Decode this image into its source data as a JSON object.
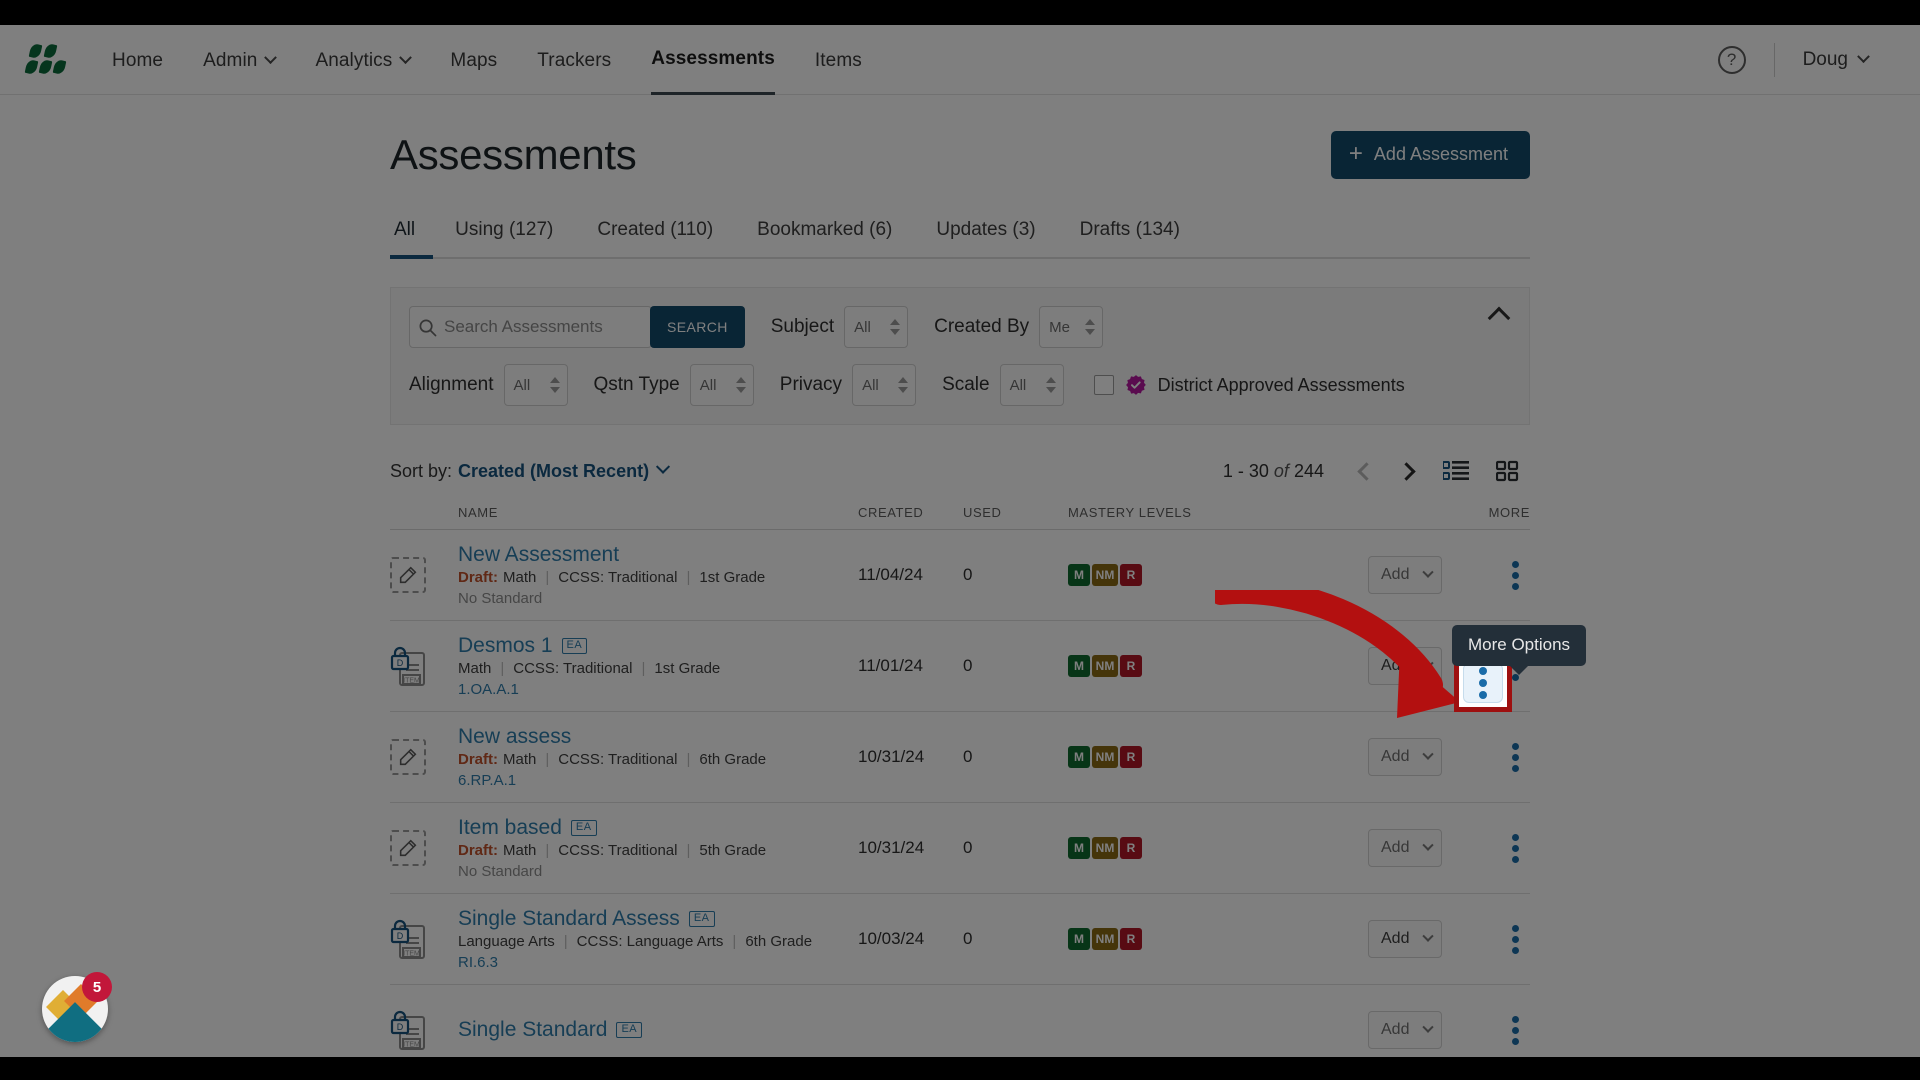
{
  "nav": {
    "logo_name": "logo-icon",
    "items": [
      {
        "label": "Home",
        "dropdown": false,
        "active": false
      },
      {
        "label": "Admin",
        "dropdown": true,
        "active": false
      },
      {
        "label": "Analytics",
        "dropdown": true,
        "active": false
      },
      {
        "label": "Maps",
        "dropdown": false,
        "active": false
      },
      {
        "label": "Trackers",
        "dropdown": false,
        "active": false
      },
      {
        "label": "Assessments",
        "dropdown": false,
        "active": true
      },
      {
        "label": "Items",
        "dropdown": false,
        "active": false
      }
    ],
    "help_icon": "?",
    "user": "Doug"
  },
  "header": {
    "title": "Assessments",
    "add_button": "Add Assessment"
  },
  "tabs": [
    {
      "label": "All",
      "active": true
    },
    {
      "label": "Using (127)",
      "active": false
    },
    {
      "label": "Created (110)",
      "active": false
    },
    {
      "label": "Bookmarked (6)",
      "active": false
    },
    {
      "label": "Updates (3)",
      "active": false
    },
    {
      "label": "Drafts (134)",
      "active": false
    }
  ],
  "search": {
    "placeholder": "Search Assessments",
    "value": "",
    "button": "SEARCH"
  },
  "filters_row1": [
    {
      "label": "Subject",
      "value": "All"
    },
    {
      "label": "Created By",
      "value": "Me"
    }
  ],
  "filters_row2": [
    {
      "label": "Alignment",
      "value": "All"
    },
    {
      "label": "Qstn Type",
      "value": "All"
    },
    {
      "label": "Privacy",
      "value": "All"
    },
    {
      "label": "Scale",
      "value": "All"
    }
  ],
  "district_checkbox": {
    "label": "District Approved Assessments",
    "checked": false,
    "badge_color": "#b5179e"
  },
  "sort": {
    "label": "Sort by:",
    "value": "Created (Most Recent)"
  },
  "pagination": {
    "range": "1 - 30",
    "of": "of",
    "total": "244"
  },
  "table": {
    "columns": [
      "NAME",
      "CREATED",
      "USED",
      "MASTERY LEVELS",
      "MORE"
    ],
    "rows": [
      {
        "icon": "draft-pencil-icon",
        "name": "New Assessment",
        "ea": false,
        "draft": "Draft:",
        "subject": "Math",
        "framework": "CCSS: Traditional",
        "grade": "1st Grade",
        "standard": "No Standard",
        "standard_link": false,
        "created": "11/04/24",
        "used": "0",
        "mastery": [
          "M",
          "NM",
          "R"
        ],
        "add": "Add",
        "add_enabled": false
      },
      {
        "icon": "locked-item-icon",
        "name": "Desmos 1",
        "ea": true,
        "draft": "",
        "subject": "Math",
        "framework": "CCSS: Traditional",
        "grade": "1st Grade",
        "standard": "1.OA.A.1",
        "standard_link": true,
        "created": "11/01/24",
        "used": "0",
        "mastery": [
          "M",
          "NM",
          "R"
        ],
        "add": "Add",
        "add_enabled": true
      },
      {
        "icon": "draft-pencil-icon",
        "name": "New assess",
        "ea": false,
        "draft": "Draft:",
        "subject": "Math",
        "framework": "CCSS: Traditional",
        "grade": "6th Grade",
        "standard": "6.RP.A.1",
        "standard_link": true,
        "created": "10/31/24",
        "used": "0",
        "mastery": [
          "M",
          "NM",
          "R"
        ],
        "add": "Add",
        "add_enabled": false
      },
      {
        "icon": "draft-pencil-icon",
        "name": "Item based",
        "ea": true,
        "draft": "Draft:",
        "subject": "Math",
        "framework": "CCSS: Traditional",
        "grade": "5th Grade",
        "standard": "No Standard",
        "standard_link": false,
        "created": "10/31/24",
        "used": "0",
        "mastery": [
          "M",
          "NM",
          "R"
        ],
        "add": "Add",
        "add_enabled": false
      },
      {
        "icon": "locked-item-icon",
        "name": "Single Standard Assess",
        "ea": true,
        "draft": "",
        "subject": "Language Arts",
        "framework": "CCSS: Language Arts",
        "grade": "6th Grade",
        "standard": "RI.6.3",
        "standard_link": true,
        "created": "10/03/24",
        "used": "0",
        "mastery": [
          "M",
          "NM",
          "R"
        ],
        "add": "Add",
        "add_enabled": true
      },
      {
        "icon": "locked-item-icon",
        "name": "Single Standard",
        "ea": true,
        "draft": "",
        "subject": "",
        "framework": "",
        "grade": "",
        "standard": "",
        "standard_link": false,
        "created": "",
        "used": "",
        "mastery": [],
        "add": "Add",
        "add_enabled": false
      }
    ]
  },
  "tooltip": {
    "text": "More Options"
  },
  "fab": {
    "badge": "5"
  },
  "colors": {
    "accent_blue": "#17537e",
    "link_blue": "#2f7cab",
    "mastery_m": "#0f6b2f",
    "mastery_nm": "#8a6a15",
    "mastery_r": "#b01627",
    "highlight_red": "#9e1010",
    "draft_orange": "#c0502a"
  }
}
